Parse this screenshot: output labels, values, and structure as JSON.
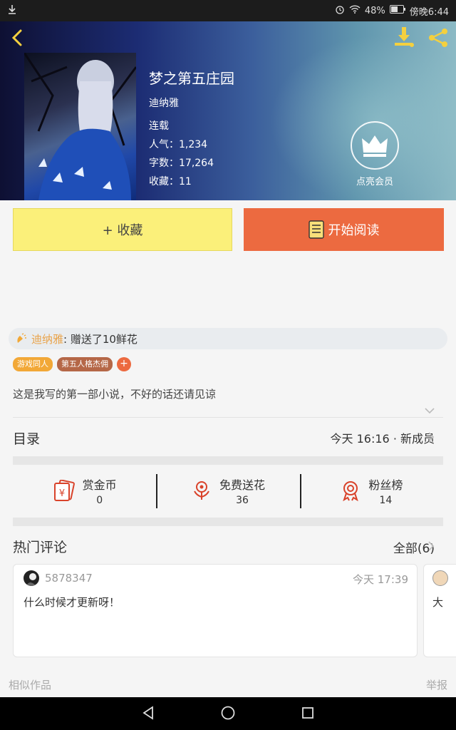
{
  "status_bar": {
    "battery": "48%",
    "time": "傍晚6:44"
  },
  "book": {
    "title": "梦之第五庄园",
    "author": "迪纳雅",
    "status": "连载",
    "popularity": "人气：1,234",
    "word_count": "字数：17,264",
    "favorites": "收藏：11"
  },
  "vip": {
    "label": "点亮会员"
  },
  "actions": {
    "favorite_label": "+ 收藏",
    "read_label": "开始阅读"
  },
  "gift": {
    "user": "迪纳雅",
    "text": ": 赠送了10鲜花"
  },
  "tags": [
    "游戏同人",
    "第五人格杰佣"
  ],
  "tag_add": "+",
  "description": "这是我写的第一部小说，不好的话还请见谅",
  "toc": {
    "title": "目录",
    "meta": "今天 16:16 · 新成员"
  },
  "stats": [
    {
      "label": "赏金币",
      "value": "0",
      "icon": "reward-coin-icon"
    },
    {
      "label": "免费送花",
      "value": "36",
      "icon": "flower-icon"
    },
    {
      "label": "粉丝榜",
      "value": "14",
      "icon": "medal-icon"
    }
  ],
  "comments_section": {
    "title": "热门评论",
    "all_label": "全部(6)"
  },
  "comments": [
    {
      "user": "5878347",
      "time": "今天 17:39",
      "text": "什么时候才更新呀！"
    },
    {
      "text": "大"
    }
  ],
  "footer": {
    "similar": "相似作品",
    "report": "举报"
  },
  "colors": {
    "accent_orange": "#ec6a40",
    "favorite_yellow": "#fbf07a",
    "tag_orange": "#f2a837",
    "tag_brown": "#b56747",
    "gift_user": "#e9a34a"
  }
}
